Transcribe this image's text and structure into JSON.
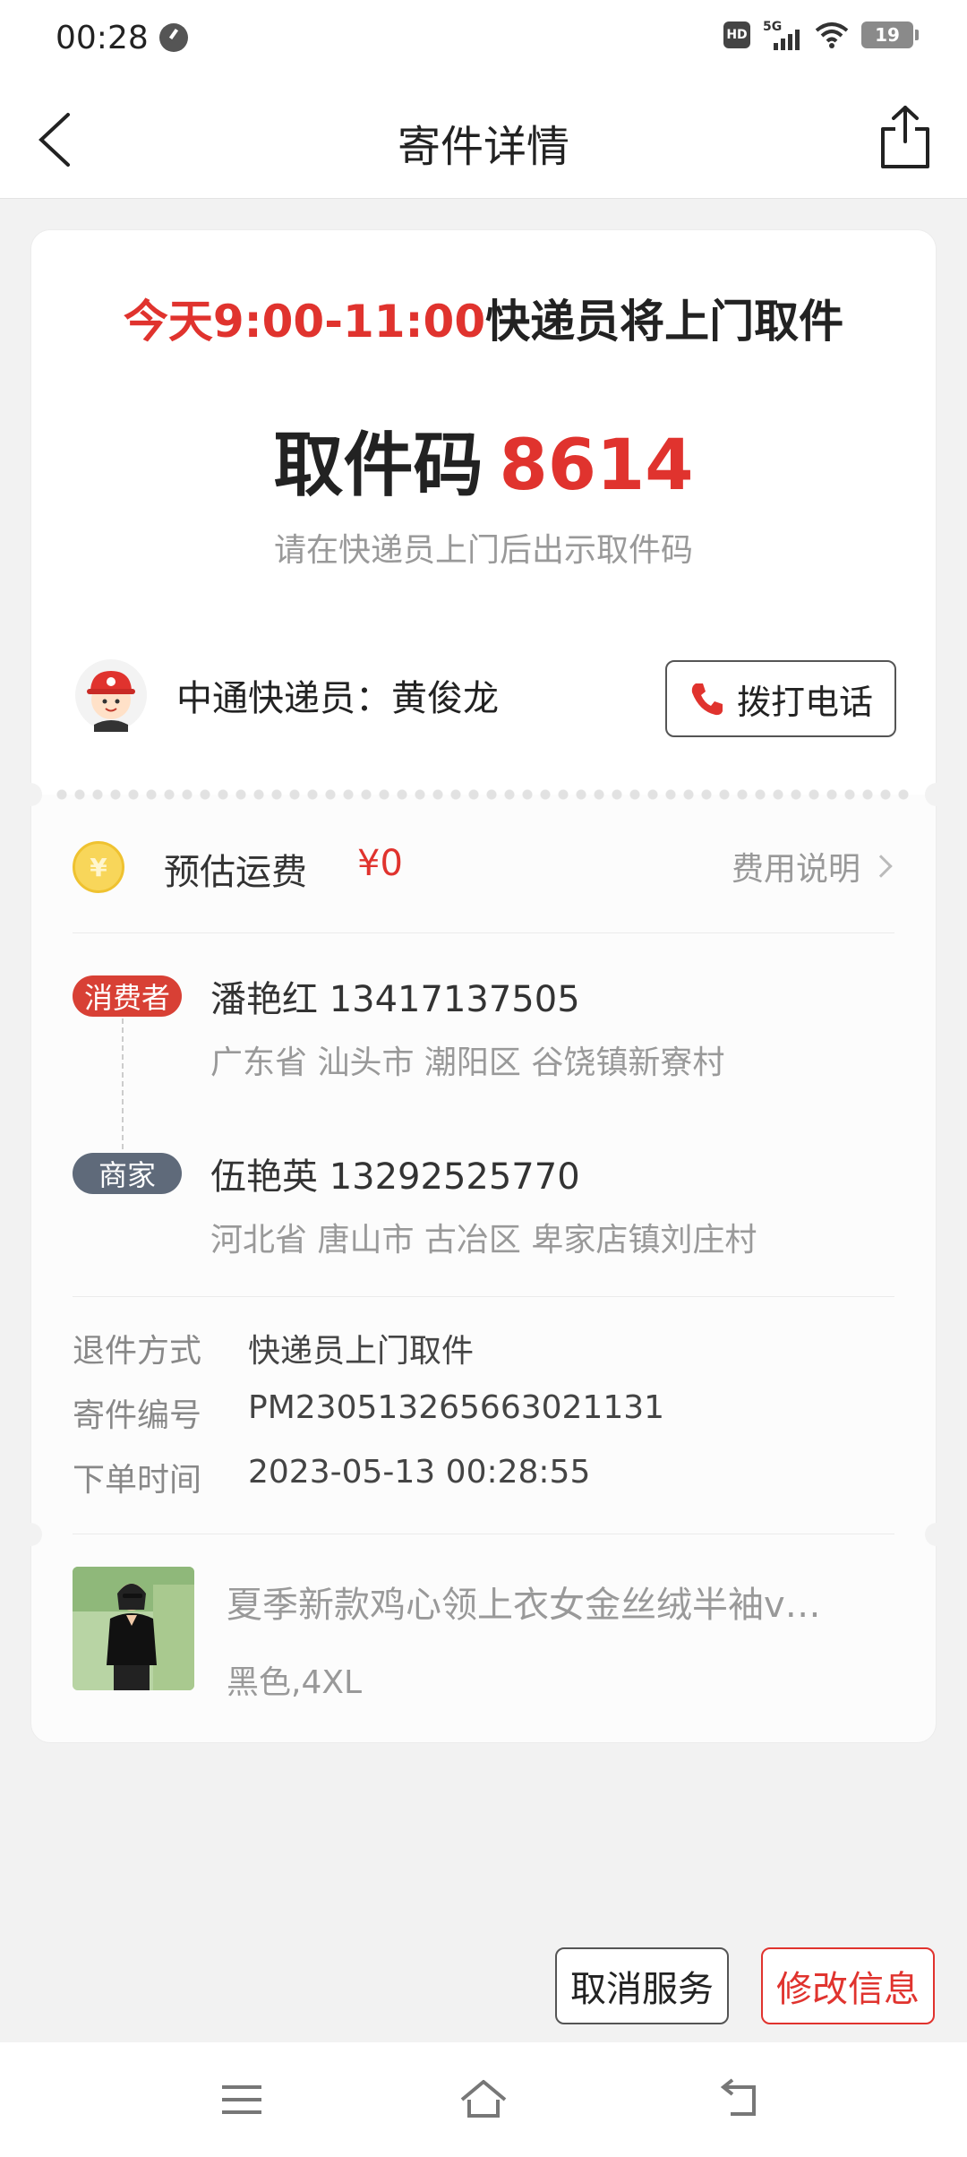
{
  "status_bar": {
    "time": "00:28",
    "hd": "HD",
    "network": "5G",
    "battery": "19"
  },
  "header": {
    "title": "寄件详情"
  },
  "pickup": {
    "notice_time": "今天9:00-11:00",
    "notice_text": "快递员将上门取件",
    "code_label": "取件码",
    "code_value": "8614",
    "hint": "请在快递员上门后出示取件码"
  },
  "courier": {
    "label": "中通快递员：黄俊龙",
    "call_label": "拨打电话"
  },
  "fee": {
    "coin_symbol": "¥",
    "label": "预估运费",
    "value": "¥0",
    "explain": "费用说明"
  },
  "consumer": {
    "tag": "消费者",
    "name_phone": "潘艳红 13417137505",
    "address": "广东省 汕头市 潮阳区 谷饶镇新寮村"
  },
  "merchant": {
    "tag": "商家",
    "name_phone": "伍艳英 13292525770",
    "address": "河北省 唐山市 古冶区 卑家店镇刘庄村"
  },
  "info": {
    "return_method_label": "退件方式",
    "return_method_value": "快递员上门取件",
    "order_no_label": "寄件编号",
    "order_no_value": "PM230513265663021131",
    "order_time_label": "下单时间",
    "order_time_value": "2023-05-13 00:28:55"
  },
  "product": {
    "title": "夏季新款鸡心领上衣女金丝绒半袖v…",
    "spec": "黑色,4XL"
  },
  "actions": {
    "cancel": "取消服务",
    "modify": "修改信息"
  },
  "colors": {
    "accent_red": "#e0332e",
    "merchant_tag": "#5f6a7a"
  }
}
